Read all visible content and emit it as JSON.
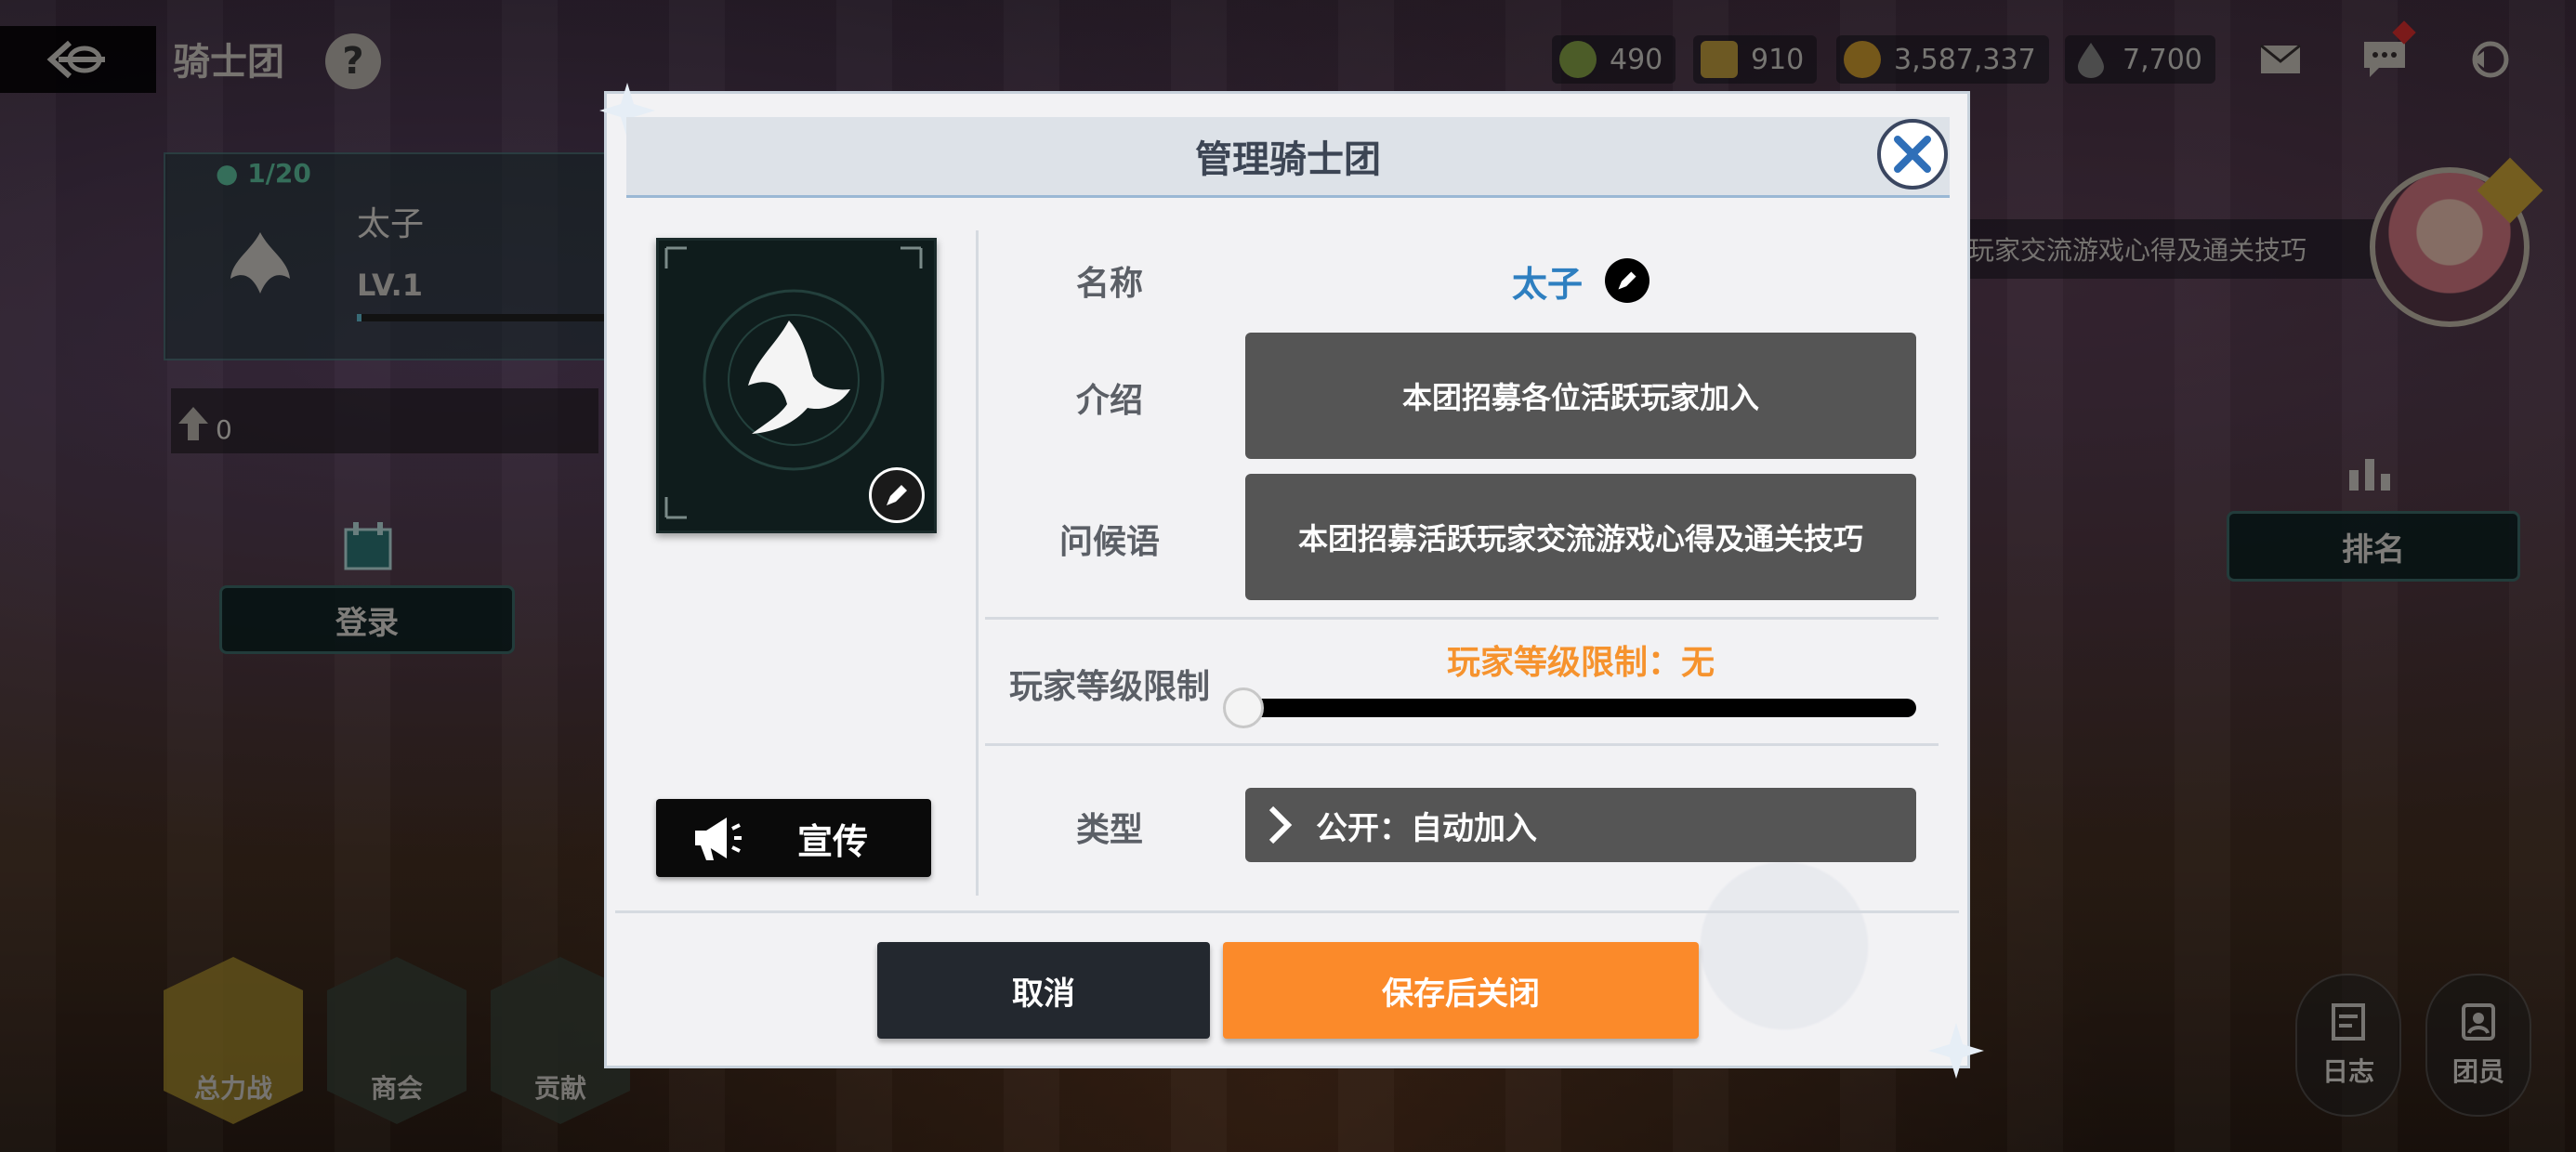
{
  "header": {
    "title": "骑士团",
    "help": "?"
  },
  "currencies": [
    {
      "icon": "clover-coin-icon",
      "value": "490",
      "color": "#8aa84a"
    },
    {
      "icon": "medal-icon",
      "value": "910",
      "color": "#c6a240"
    },
    {
      "icon": "gold-coin-icon",
      "value": "3,587,337",
      "color": "#d6a030"
    },
    {
      "icon": "drop-icon",
      "value": "7,700",
      "color": "#8a8a8a"
    }
  ],
  "left_panel": {
    "member_count": "1/20",
    "guild_name": "太子",
    "level": "LV.1",
    "level_progress": 0.02,
    "contribution": "0",
    "login_label": "登录",
    "nav": [
      {
        "icon": "fist-icon",
        "label": "总力战"
      },
      {
        "icon": "basket-icon",
        "label": "商会"
      },
      {
        "icon": "clover-icon",
        "label": "贡献"
      }
    ]
  },
  "right_panel": {
    "greeting_preview": "玩家交流游戏心得及通关技巧",
    "ranking_label": "排名",
    "log_label": "日志",
    "members_label": "团员"
  },
  "dialog": {
    "title": "管理骑士团",
    "promo_label": "宣传",
    "name_label": "名称",
    "name_value": "太子",
    "intro_label": "介绍",
    "intro_value": "本团招募各位活跃玩家加入",
    "greeting_label": "问候语",
    "greeting_value": "本团招募活跃玩家交流游戏心得及通关技巧",
    "level_limit_label": "玩家等级限制",
    "level_limit_value": "玩家等级限制：无",
    "level_limit_slider": 0,
    "type_label": "类型",
    "type_value": "公开：自动加入",
    "cancel_label": "取消",
    "save_label": "保存后关闭"
  }
}
